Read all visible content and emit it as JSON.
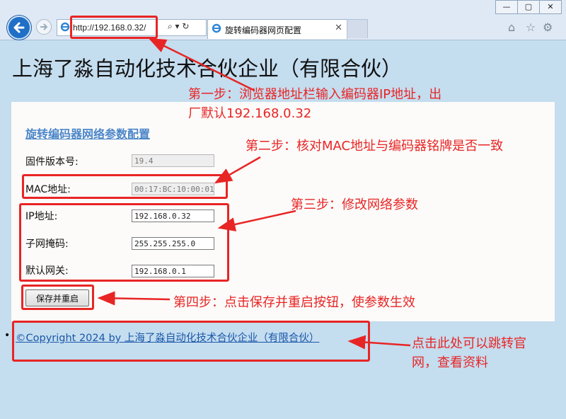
{
  "browser": {
    "window_buttons": [
      "—",
      "▢",
      "✕"
    ],
    "address_url": "http://192.168.0.32/",
    "tab_title": "旋转编码器网页配置",
    "address_tools": "⌕ ▾ ↻"
  },
  "page": {
    "title": "上海了淼自动化技术合伙企业（有限合伙）",
    "form_heading": "旋转编码器网络参数配置",
    "fields": {
      "firmware": {
        "label": "固件版本号:",
        "value": "19.4"
      },
      "mac": {
        "label": "MAC地址:",
        "value": "00:17:BC:10:00:01"
      },
      "ip": {
        "label": "IP地址:",
        "value": "192.168.0.32"
      },
      "subnet": {
        "label": "子网掩码:",
        "value": "255.255.255.0"
      },
      "gateway": {
        "label": "默认网关:",
        "value": "192.168.0.1"
      }
    },
    "save_button": "保存并重启",
    "copyright": "©Copyright 2024 by 上海了淼自动化技术合伙企业（有限合伙）"
  },
  "annotations": {
    "step1_line1": "第一步：浏览器地址栏输入编码器IP地址，出",
    "step1_line2": "厂默认192.168.0.32",
    "step2": "第二步：核对MAC地址与编码器铭牌是否一致",
    "step3": "第三步：修改网络参数",
    "step4": "第四步：点击保存并重启按钮，使参数生效",
    "step5_line1": "点击此处可以跳转官",
    "step5_line2": "网，查看资料",
    "color": "#e82525"
  }
}
